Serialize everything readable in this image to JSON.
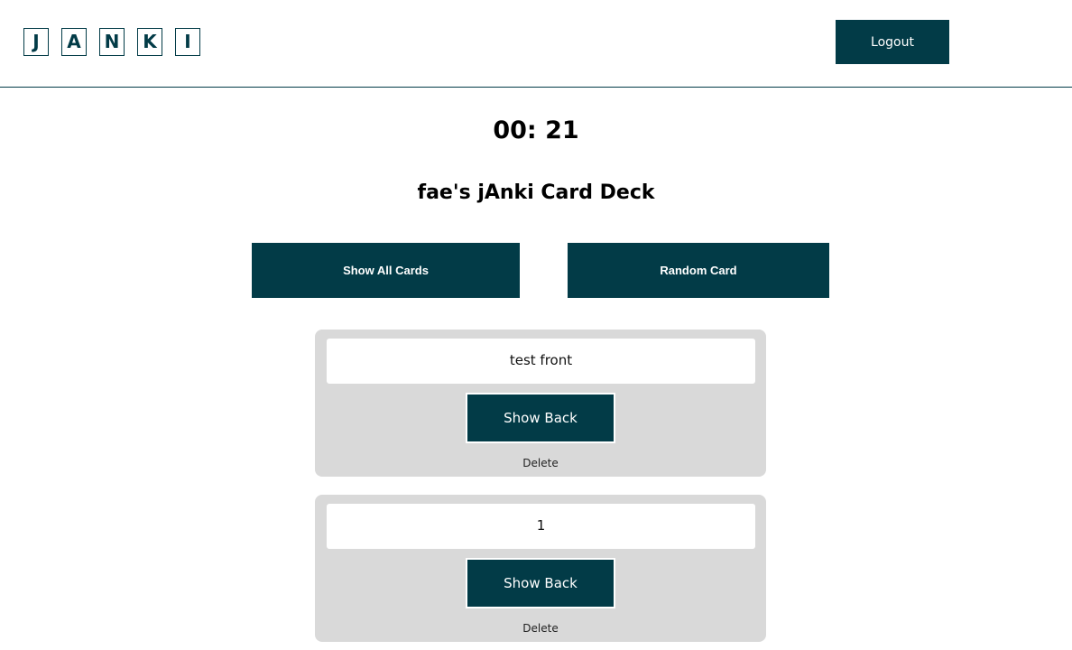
{
  "header": {
    "logo_letters": [
      "J",
      "A",
      "N",
      "K",
      "I"
    ],
    "logout_label": "Logout"
  },
  "timer": "00: 21",
  "deck_title": "fae's jAnki Card Deck",
  "actions": {
    "show_all_label": "Show All Cards",
    "random_label": "Random Card"
  },
  "cards": [
    {
      "front": "test front",
      "show_back_label": "Show Back",
      "delete_label": "Delete"
    },
    {
      "front": "1",
      "show_back_label": "Show Back",
      "delete_label": "Delete"
    }
  ],
  "colors": {
    "accent": "#023b47",
    "card_background": "#d9d9d9"
  }
}
